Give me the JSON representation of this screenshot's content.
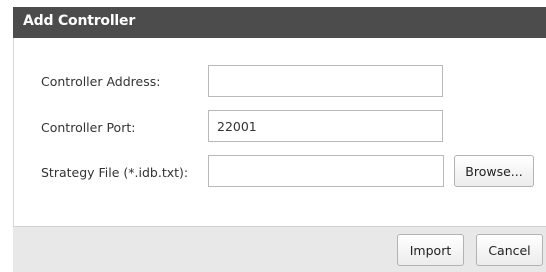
{
  "dialog": {
    "title": "Add Controller"
  },
  "form": {
    "address_label": "Controller Address:",
    "address_value": "",
    "port_label": "Controller Port:",
    "port_value": "22001",
    "strategy_label": "Strategy File (*.idb.txt):",
    "strategy_value": "",
    "browse_label": "Browse..."
  },
  "footer": {
    "import_label": "Import",
    "cancel_label": "Cancel"
  }
}
